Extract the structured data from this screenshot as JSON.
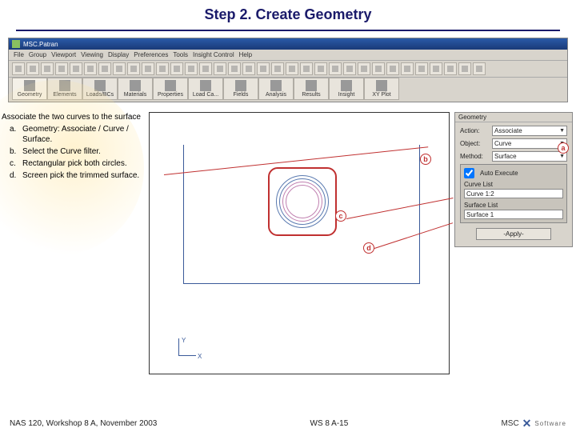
{
  "header": {
    "title": "Step 2. Create Geometry"
  },
  "app": {
    "title": "MSC.Patran",
    "menu": [
      "File",
      "Group",
      "Viewport",
      "Viewing",
      "Display",
      "Preferences",
      "Tools",
      "Insight Control",
      "Help"
    ],
    "tabs": [
      "Geometry",
      "Elements",
      "Loads/BCs",
      "Materials",
      "Properties",
      "Load Ca...",
      "Fields",
      "Analysis",
      "Results",
      "Insight",
      "XY Plot"
    ]
  },
  "instructions": {
    "lead": "Associate the two curves to the surface",
    "items": [
      {
        "lbl": "a.",
        "txt": "Geometry: Associate / Curve / Surface."
      },
      {
        "lbl": "b.",
        "txt": "Select the Curve filter."
      },
      {
        "lbl": "c.",
        "txt": "Rectangular pick both circles."
      },
      {
        "lbl": "d.",
        "txt": "Screen pick the trimmed surface."
      }
    ]
  },
  "coord": {
    "x": "X",
    "y": "Y"
  },
  "panel": {
    "title": "Geometry",
    "action_lbl": "Action:",
    "action_val": "Associate",
    "object_lbl": "Object:",
    "object_val": "Curve",
    "method_lbl": "Method:",
    "method_val": "Surface",
    "auto_exec": "Auto Execute",
    "curve_list_lbl": "Curve List",
    "curve_list_val": "Curve 1:2",
    "surface_list_lbl": "Surface List",
    "surface_list_val": "Surface 1",
    "apply": "-Apply-"
  },
  "callouts": {
    "a": "a",
    "b": "b",
    "c": "c",
    "d": "d"
  },
  "footer": {
    "left": "NAS 120, Workshop 8 A, November 2003",
    "center": "WS 8 A-15",
    "brand1": "MSC",
    "brand2": "Software"
  }
}
